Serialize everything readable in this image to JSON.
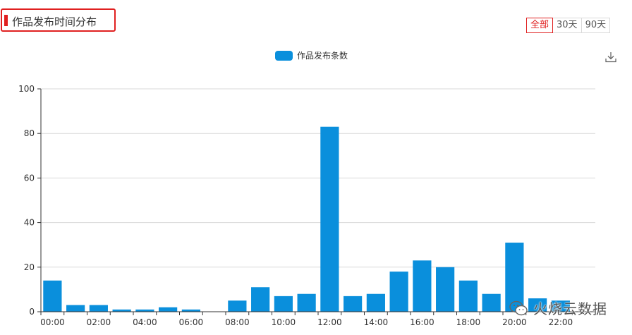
{
  "header": {
    "title": "作品发布时间分布"
  },
  "range_tabs": [
    {
      "label": "全部",
      "active": true
    },
    {
      "label": "30天",
      "active": false
    },
    {
      "label": "90天",
      "active": false
    }
  ],
  "toolbar": {
    "download_icon": "download-icon"
  },
  "legend": {
    "label": "作品发布条数",
    "color": "#0a8fdc"
  },
  "watermark": {
    "text": "火烧云数据",
    "icon": "wechat-icon"
  },
  "chart_data": {
    "type": "bar",
    "categories": [
      "00:00",
      "01:00",
      "02:00",
      "03:00",
      "04:00",
      "05:00",
      "06:00",
      "07:00",
      "08:00",
      "09:00",
      "10:00",
      "11:00",
      "12:00",
      "13:00",
      "14:00",
      "15:00",
      "16:00",
      "17:00",
      "18:00",
      "19:00",
      "20:00",
      "21:00",
      "22:00",
      "23:00"
    ],
    "tick_labels": [
      "00:00",
      "02:00",
      "04:00",
      "06:00",
      "08:00",
      "10:00",
      "12:00",
      "14:00",
      "16:00",
      "18:00",
      "20:00",
      "22:00"
    ],
    "series": [
      {
        "name": "作品发布条数",
        "color": "#0a8fdc",
        "values": [
          14,
          3,
          3,
          1,
          1,
          2,
          1,
          0,
          5,
          11,
          7,
          8,
          83,
          7,
          8,
          18,
          23,
          20,
          14,
          8,
          31,
          6,
          5,
          0
        ]
      }
    ],
    "ylim": [
      0,
      100
    ],
    "yticks": [
      0,
      20,
      40,
      60,
      80,
      100
    ],
    "grid": true,
    "legend_position": "top-center"
  }
}
